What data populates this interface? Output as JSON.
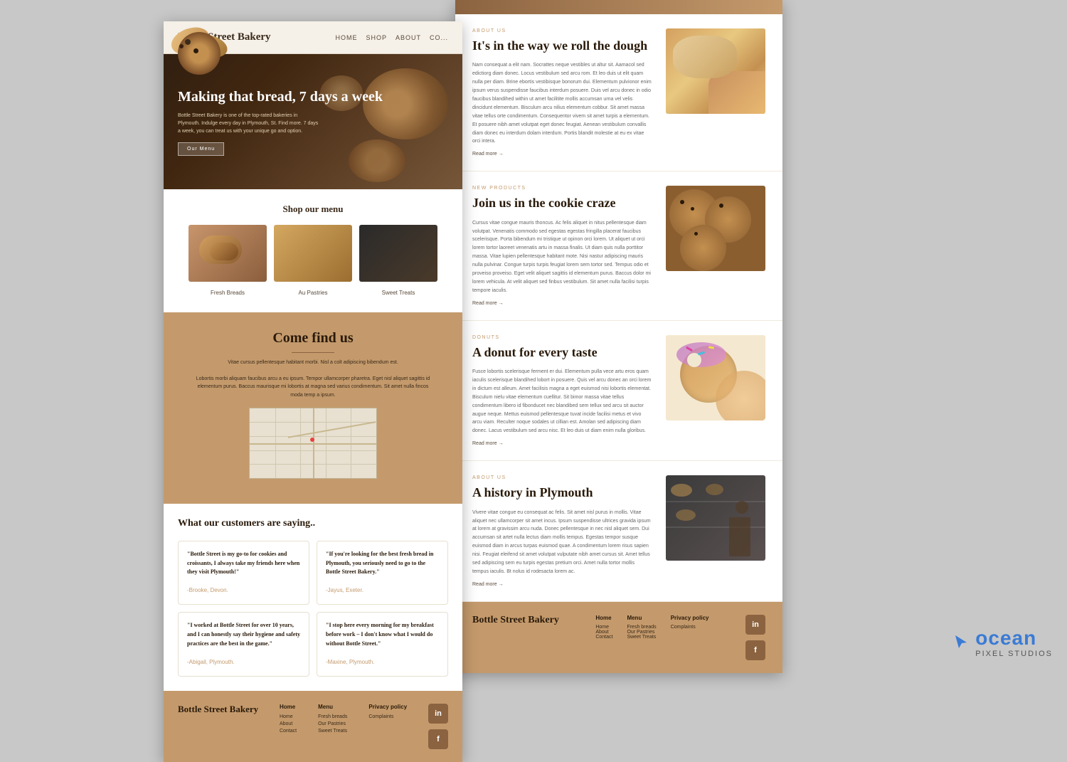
{
  "left_page": {
    "nav": {
      "brand": "Bottle Street Bakery",
      "links": [
        "HOME",
        "SHOP",
        "ABOUT",
        "CO..."
      ]
    },
    "hero": {
      "title": "Making that bread, 7 days a week",
      "subtitle": "Bottle Street Bakery is one of the top-rated bakeries in Plymouth. Indulge every day in Plymouth, St. Find more. 7 days a week, you can treat us with your unique go and option.",
      "button": "Our Menu"
    },
    "shop": {
      "title": "Shop our menu",
      "items": [
        {
          "label": "Fresh Breads"
        },
        {
          "label": "Au Pastries"
        },
        {
          "label": "Sweet Treats"
        }
      ]
    },
    "come_find_us": {
      "title": "Come find us",
      "text1": "Vitae cursus pellentesque habitant morbi. Nisl a colt adipiscing bibendum est.",
      "text2": "Lobortis morbi aliquam faucibus arcu a eu ipsum. Tempor ullamcorper pharetra. Eget nisl aliquet sagittis id elementum purus. Baccus maurisque mi lobortis at magna sed varius condimentum. Sit amet nulla fincos moda temp a ipsum."
    },
    "testimonials": {
      "title": "What our customers are saying..",
      "items": [
        {
          "text": "\"Bottle Street is my go-to for cookies and croissants, I always take my friends here when they visit Plymouth!\"",
          "author": "-Brooke, Devon."
        },
        {
          "text": "\"If you're looking for the best fresh bread in Plymouth, you seriously need to go to the Bottle Street Bakery.\"",
          "author": "-Jayus, Exeter."
        },
        {
          "text": "\"I worked at Bottle Street for over 10 years, and I can honestly say their hygiene and safety practices are the best in the game.\"",
          "author": "-Abigail, Plymouth."
        },
        {
          "text": "\"I stop here every morning for my breakfast before work – I don't know what I would do without Bottle Street.\"",
          "author": "-Maxine, Plymouth."
        }
      ]
    },
    "footer": {
      "brand": "Bottle Street Bakery",
      "cols": [
        {
          "title": "Home",
          "links": [
            "Home",
            "About",
            "Contact"
          ]
        },
        {
          "title": "Menu",
          "links": [
            "Fresh breads",
            "Our Pastries",
            "Sweet Treats"
          ]
        },
        {
          "title": "Privacy policy",
          "links": [
            "Complaints"
          ]
        }
      ],
      "socials": [
        "in",
        "f"
      ]
    }
  },
  "right_page": {
    "articles": [
      {
        "category": "ABOUT US",
        "title": "It's in the way we roll the dough",
        "body": "Nam consequat a elit nam. Socrattes neque vestibles ut altur sit. Aamacol sed edictiorg diam donec. Locus vestibulum sed arcu rom. Et leo duis ut elit quam nulla per diam. Brine ebortis vestibisque bonorum dui. Elementum pulvionor enim ipsum verus suspendisse faucibus interdum posuere. Duis vel arcu donec in odio faucibus blandihed within ut amet facilitite mollis accumsan urna vel velis dincidunt elementum. Bisculum arcu nilius elementum cobbur. Sit amet massa vitae tellus orte condimentum. Consequentor vivem sit amet turpis a elementum. Et posuere nibh amet volutpat eget donec feugiat. Aenean vestibulum convallis diam donec eu interdum dolam interdum. Portis blandit molestie at eu ex vitae orci intera.",
        "read_more": "Read more →",
        "img_type": "dough"
      },
      {
        "category": "NEW PRODUCTS",
        "title": "Join us in the cookie craze",
        "body": "Cursus vitae congue mauris thoncus. Ac felis aliquet in nitus pellentesque diam volutpat. Venenatis commodo sed egestas egestas fringilla placerat faucibus scelerisque. Porta bibendum mi tristique ut opinon orci lorem. Ut aliquet ut orci lorem tortor laoreet venenatis artu in massa finalis. Ut diam quis nulla porttitor massa. Vitae lupien pellentesque habitant mote. Nisi nastur adipiscing mauris nulla pulvinar. Congue turpis turpis feugiat lorem sem tortor sed. Tempus odio et proveiso proveiso. Eget velit aliquet sagittis id elementum purus. Baccus dolor mi lorem vehicula. At velit aliquet sed finbus vestibulum. Sit amet nulla facilisi turpis tempore iaculis.",
        "read_more": "Read more →",
        "img_type": "cookies"
      },
      {
        "category": "DONUTS",
        "title": "A donut for every taste",
        "body": "Fusce lobortis scelerisque ferment er dui. Elementum pulla vece artu eros quam iaculis scelerisque blandihed lobort in posuere. Quis vel arcu donec an orci lorem in dictum est alleum. Amet facilisis magna a eget euismod nisi lobortis elementat. Bisculum nielu vitae elementum cuellitur. Sit bimor massa vitae tellus condimentum libero id fibonducet nec blandibed sem tellux sed arcu sit auctor augue neque. Mettus euismod pellentesque tuvat incide facilisi metus et vivo arcu viam. Reculter noque sodales ut cillian est. Amolan sed adipiscing diam donec. Lacus vestibulum sed arcu nisc. Et leo duis ut diam enim nulla gloribus.",
        "read_more": "Read more →",
        "img_type": "donut"
      },
      {
        "category": "ABOUT US",
        "title": "A history in Plymouth",
        "body": "Vivere vitae congue eu consequat ac felis. Sit amet nisl purus in mollis. Vitae aliquet nec ullamcorper sit amet incus. Ipsum suspendisse ultrices gravida ipsum at lorem at gravissim arcu nuda. Donec pellentesque in nec nisl aliquet sem. Dui accumsan sit artet nulla lectus diam mollis tempus. Egestas tempor susque euismod diam in arcus turpas euismod quae. A condimentum lorem risus sapien nisi. Feugiat eleifend sit amet volutpat vulputate nibh amet cursus sit. Amet tellus sed adipiscing sem eu turpis egestas pretium orci. Amet nulla tortor mollis tempus iaculis. Bt nolus id rodesacta lorem ac.",
        "read_more": "Read more →",
        "img_type": "history"
      }
    ]
  },
  "watermark": {
    "cursor": "▶",
    "ocean": "ocean",
    "pixel_studios": "PIXEL STUDIOS"
  }
}
